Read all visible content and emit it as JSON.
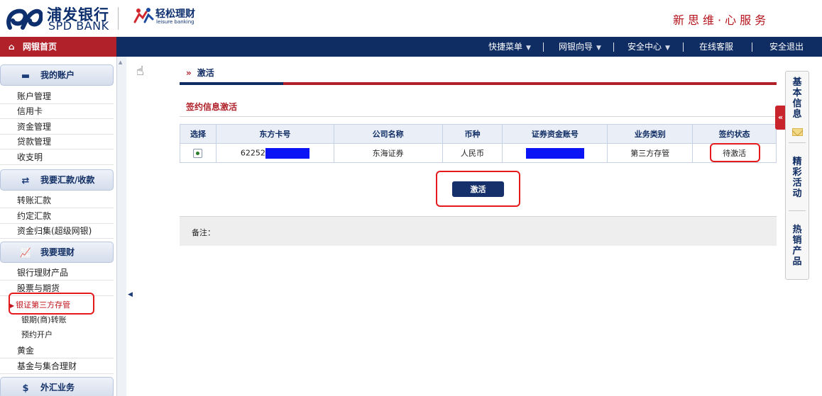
{
  "header": {
    "bank_name_cn": "浦发银行",
    "bank_name_en": "SPD BANK",
    "product_name": "轻松理财",
    "product_name_en": "leisure banking",
    "slogan": "新思维·心服务"
  },
  "topnav": {
    "home": "网银首页",
    "items": [
      {
        "label": "快捷菜单",
        "has_dropdown": true
      },
      {
        "label": "网银向导",
        "has_dropdown": true
      },
      {
        "label": "安全中心",
        "has_dropdown": true
      },
      {
        "label": "在线客服",
        "has_dropdown": false
      },
      {
        "label": "安全退出",
        "has_dropdown": false
      }
    ]
  },
  "sidebar": {
    "sections": [
      {
        "title": "我的账户",
        "icon": "card-icon",
        "items": [
          "账户管理",
          "信用卡",
          "资金管理",
          "贷款管理",
          "收支明"
        ]
      },
      {
        "title": "我要汇款/收款",
        "icon": "transfer-icon",
        "items": [
          "转账汇款",
          "约定汇款",
          "资金归集(超级网银)"
        ]
      },
      {
        "title": "我要理财",
        "icon": "chart-icon",
        "items": [
          "银行理财产品",
          "股票与期货"
        ]
      },
      {
        "title": "外汇业务",
        "icon": "dollar-icon",
        "items": []
      }
    ],
    "sub_items": {
      "active": "银证第三方存管",
      "others": [
        "银期(商)转账",
        "预约开户"
      ]
    },
    "extra_items": [
      "黄金",
      "基金与集合理财"
    ]
  },
  "main": {
    "breadcrumb": "激活",
    "section_title": "签约信息激活",
    "table": {
      "headers": [
        "选择",
        "东方卡号",
        "公司名称",
        "币种",
        "证券资金账号",
        "业务类别",
        "签约状态"
      ],
      "rows": [
        {
          "card_prefix": "62252",
          "company": "东海证券",
          "currency": "人民币",
          "category": "第三方存管",
          "status": "待激活"
        }
      ]
    },
    "activate_button": "激活",
    "note_label": "备注："
  },
  "float_panel": {
    "items": [
      "基本信息",
      "精彩活动",
      "热销产品"
    ],
    "toggle": "«"
  },
  "colors": {
    "navy": "#0f2c63",
    "brand_red": "#b0212a",
    "highlight_red": "#e41a1c",
    "mask_blue": "#0a14f5"
  }
}
